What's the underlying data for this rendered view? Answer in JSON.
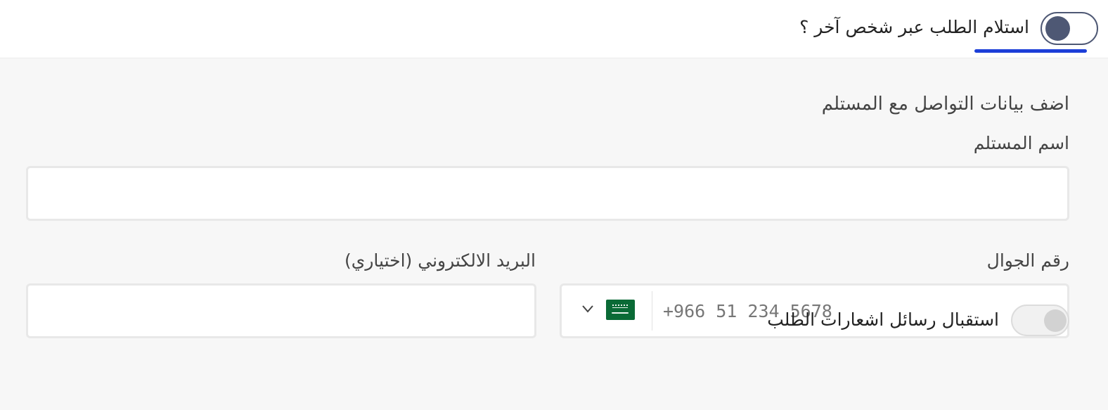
{
  "alt_recipient_toggle": {
    "label": "استلام الطلب عبر شخص آخر ؟",
    "state": "on"
  },
  "contact_section": {
    "title": "اضف بيانات التواصل مع المستلم",
    "recipient_name": {
      "label": "اسم المستلم",
      "value": ""
    },
    "phone": {
      "label": "رقم الجوال",
      "placeholder": "+966 51 234 5678",
      "country_flag": "saudi-arabia-flag-icon",
      "dropdown_icon": "chevron-down-icon"
    },
    "email": {
      "label": "البريد الالكتروني (اختياري)",
      "value": ""
    }
  },
  "notifications_toggle": {
    "label": "استقبال رسائل اشعارات الطلب",
    "state": "off"
  },
  "colors": {
    "toggle_on": "#4e5874",
    "focus_underline": "#1d3fd8",
    "panel_bg": "#f7f7f7",
    "flag_green": "#0a6a36"
  }
}
